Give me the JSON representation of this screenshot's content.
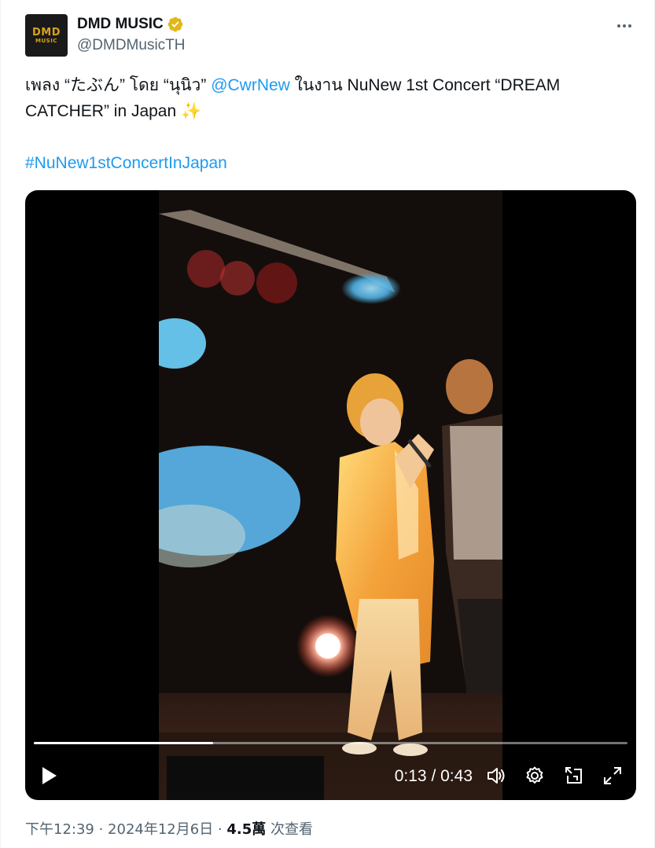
{
  "author": {
    "avatar_logo_text": "DMD",
    "avatar_logo_subtext": "MUSIC",
    "display_name": "DMD MUSIC",
    "handle": "@DMDMusicTH",
    "verified_color": "#e2b719"
  },
  "tweet": {
    "text_part1": "เพลง “たぶん” โดย “นุนิว” ",
    "mention": "@CwrNew",
    "text_part2": " ในงาน NuNew 1st Concert “DREAM CATCHER” in Japan ",
    "emoji": "✨",
    "hashtag": "#NuNew1stConcertInJapan"
  },
  "video": {
    "current_time": "0:13",
    "separator": " / ",
    "duration": "0:43",
    "progress_fraction": 0.302,
    "icons": [
      "play-icon",
      "volume-icon",
      "settings-icon",
      "picture-in-picture-icon",
      "fullscreen-icon"
    ]
  },
  "footer": {
    "time": "下午12:39",
    "sep1": " · ",
    "date": "2024年12月6日",
    "sep2": " · ",
    "views_count": "4.5萬",
    "views_label": " 次查看"
  },
  "colors": {
    "link": "#1d9bf0",
    "secondary_text": "#536471",
    "primary_text": "#0f1419",
    "avatar_gold": "#d9a21b"
  }
}
